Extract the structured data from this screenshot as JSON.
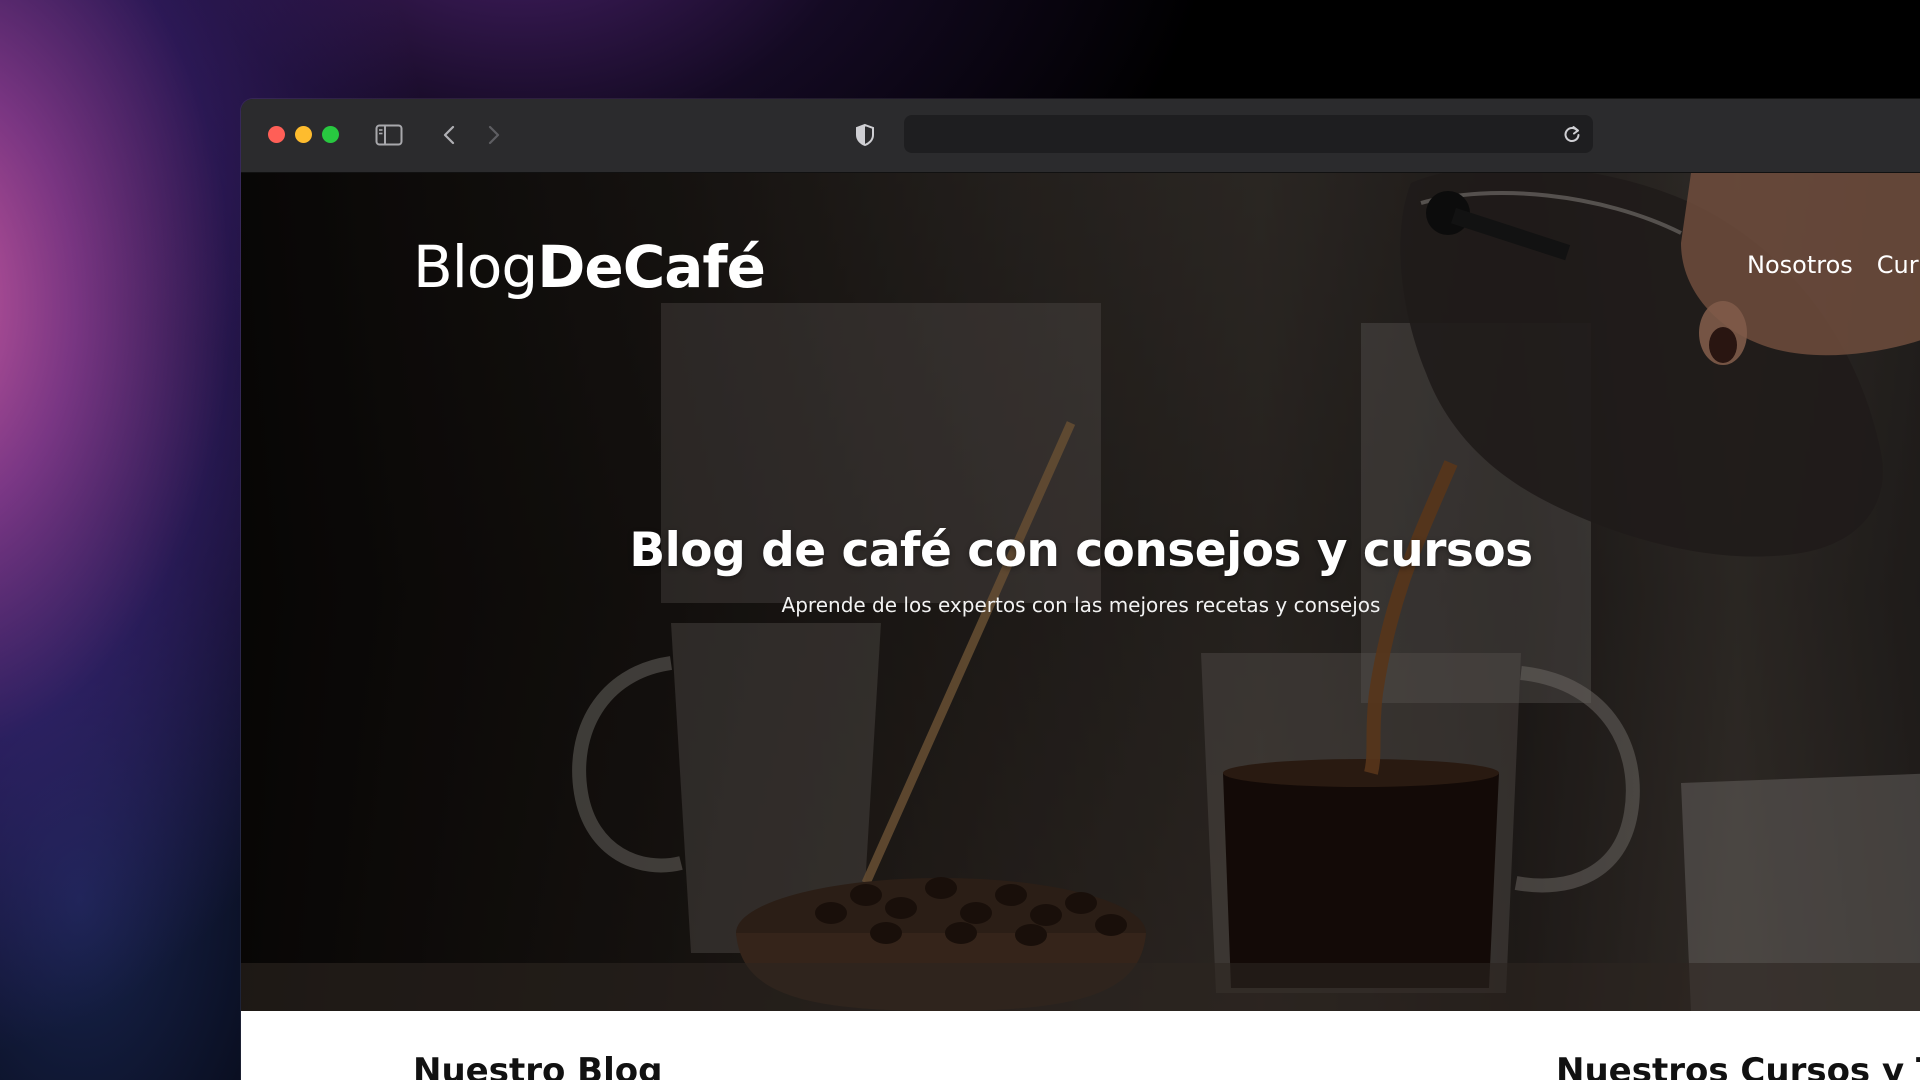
{
  "browser": {
    "url": "",
    "traffic_lights": {
      "close": "#ff5f57",
      "minimize": "#febc2e",
      "zoom": "#28c840"
    },
    "icons": [
      "sidebar-toggle-icon",
      "back-arrow-icon",
      "forward-arrow-icon",
      "shield-icon",
      "reload-icon"
    ]
  },
  "site": {
    "logo_light": "Blog",
    "logo_bold": "DeCafé",
    "nav": [
      {
        "label": "Nosotros"
      },
      {
        "label": "Cur"
      }
    ],
    "hero": {
      "title": "Blog de café con consejos y cursos",
      "subtitle": "Aprende de los expertos con las mejores recetas y consejos"
    },
    "sections": {
      "blog_heading": "Nuestro Blog",
      "courses_heading": "Nuestros Cursos y T"
    }
  }
}
